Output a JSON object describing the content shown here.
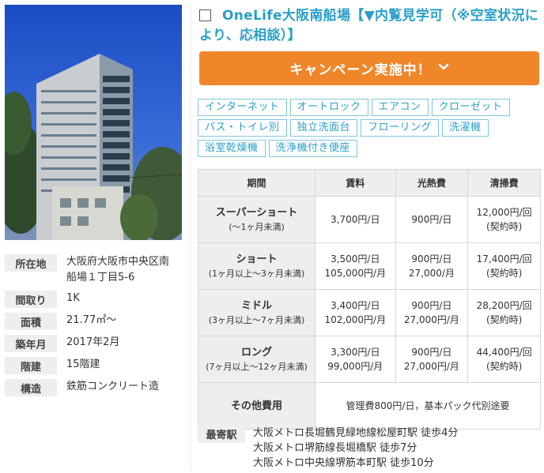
{
  "listing": {
    "title": "OneLife大阪南船場【▼内覧見学可（※空室状況により、応相談）】",
    "campaign_label": "キャンペーン実施中！",
    "campaign_icon": "chevron-down-icon",
    "accent_color": "#f0862a",
    "title_color": "#2a9fc9"
  },
  "photo": {
    "description_icon": "building-photo"
  },
  "specs": [
    {
      "label": "所在地",
      "value": "大阪府大阪市中央区南船場１丁目5-6"
    },
    {
      "label": "間取り",
      "value": "1K"
    },
    {
      "label": "面積",
      "value": "21.77㎡～"
    },
    {
      "label": "築年月",
      "value": "2017年2月"
    },
    {
      "label": "階建",
      "value": "15階建"
    },
    {
      "label": "構造",
      "value": "鉄筋コンクリート造"
    }
  ],
  "tags": [
    [
      "インターネット",
      "オートロック",
      "エアコン",
      "クローゼット"
    ],
    [
      "バス・トイレ別",
      "独立洗面台",
      "フローリング",
      "洗濯機"
    ],
    [
      "浴室乾燥機",
      "洗浄機付き便座"
    ]
  ],
  "price_table": {
    "headers": [
      "期間",
      "賃料",
      "光熱費",
      "清掃費"
    ],
    "rows": [
      {
        "name": "スーパーショート",
        "sub": "(～1ヶ月未満)",
        "rent": [
          "3,700円/日"
        ],
        "utility": [
          "900円/日"
        ],
        "cleaning": [
          "12,000円/回",
          "(契約時)"
        ]
      },
      {
        "name": "ショート",
        "sub": "(1ヶ月以上～3ヶ月未満)",
        "rent": [
          "3,500円/日",
          "105,000円/月"
        ],
        "utility": [
          "900円/日",
          "27,000/月"
        ],
        "cleaning": [
          "17,400円/回",
          "(契約時)"
        ]
      },
      {
        "name": "ミドル",
        "sub": "(3ヶ月以上～7ヶ月未満)",
        "rent": [
          "3,400円/日",
          "102,000円/月"
        ],
        "utility": [
          "900円/日",
          "27,000円/月"
        ],
        "cleaning": [
          "28,200円/回",
          "(契約時)"
        ]
      },
      {
        "name": "ロング",
        "sub": "(7ヶ月以上～12ヶ月未満)",
        "rent": [
          "3,300円/日",
          "99,000円/月"
        ],
        "utility": [
          "900円/日",
          "27,000円/月"
        ],
        "cleaning": [
          "44,400円/回",
          "(契約時)"
        ]
      }
    ],
    "other_label": "その他費用",
    "other_value": "管理費800円/日，基本パック代別途要"
  },
  "station": {
    "label": "最寄駅",
    "lines": [
      "大阪メトロ長堀鶴見緑地線松屋町駅 徒歩4分",
      "大阪メトロ堺筋線長堀橋駅 徒歩7分",
      "大阪メトロ中央線堺筋本町駅 徒歩10分"
    ]
  }
}
